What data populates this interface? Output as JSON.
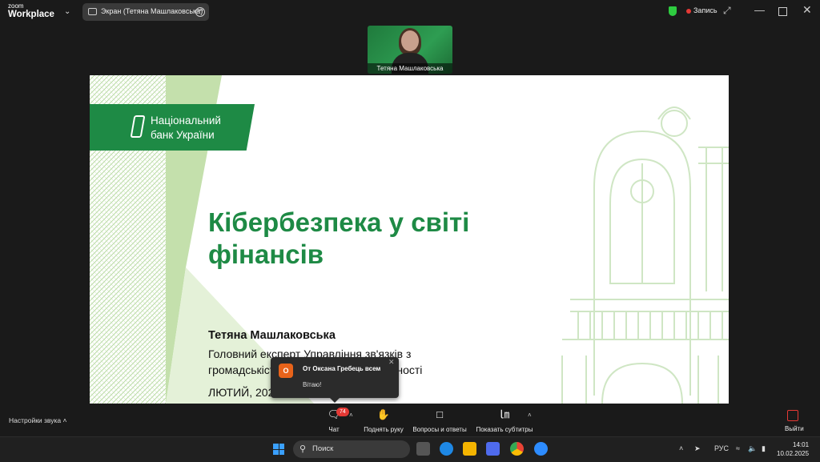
{
  "topbar": {
    "logo_small": "zoom",
    "logo_main": "Workplace",
    "screen_share_label": "Экран (Тетяна Машлаковська)",
    "record_label": "Запись",
    "icons": [
      "shield-icon",
      "expand-icon",
      "minimize-icon",
      "maximize-icon",
      "close-icon"
    ]
  },
  "video_thumb": {
    "participant_name": "Тетяна Машлаковська"
  },
  "slide": {
    "org_line1": "Національний",
    "org_line2": "банк України",
    "title_line1": "Кібербезпека у світі",
    "title_line2": "фінансів",
    "speaker_name": "Тетяна Машлаковська",
    "position_line1": "Головний експерт Управління зв'язків з",
    "position_line2": "громадськістю та фінансової грамотності",
    "date": "ЛЮТИЙ, 2025",
    "brand_color": "#1e8a45"
  },
  "toast": {
    "avatar_letter": "О",
    "from": "От Оксана Гребець всем",
    "message": "Вітаю!"
  },
  "bottombar": {
    "audio_settings": "Настройки звука",
    "chat_label": "Чат",
    "chat_badge": "74",
    "raise_hand_label": "Поднять руку",
    "qa_label": "Вопросы и ответы",
    "captions_label": "Показать субтитры",
    "leave_label": "Выйти"
  },
  "taskbar": {
    "search_placeholder": "Поиск",
    "language": "РУС",
    "time": "14:01",
    "date": "10.02.2025"
  }
}
